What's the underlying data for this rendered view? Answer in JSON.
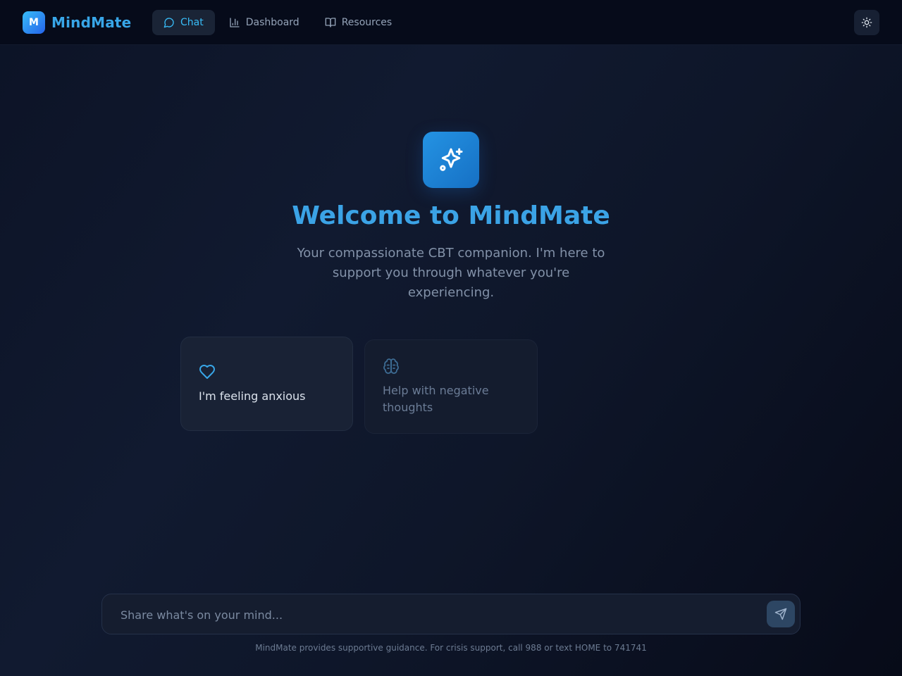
{
  "app": {
    "logo_letter": "M",
    "name": "MindMate"
  },
  "nav": {
    "items": [
      {
        "label": "Chat",
        "icon": "chat-bubble-icon",
        "active": true
      },
      {
        "label": "Dashboard",
        "icon": "bar-chart-icon",
        "active": false
      },
      {
        "label": "Resources",
        "icon": "book-open-icon",
        "active": false
      }
    ]
  },
  "theme_toggle": {
    "icon": "sun-icon"
  },
  "hero": {
    "icon": "sparkles-icon",
    "title": "Welcome to MindMate",
    "subtitle": "Your compassionate CBT companion. I'm here to support you through whatever you're experiencing."
  },
  "suggestions": [
    {
      "label": "I'm feeling anxious",
      "icon": "heart-icon"
    },
    {
      "label": "Help with negative thoughts",
      "icon": "brain-icon"
    }
  ],
  "composer": {
    "placeholder": "Share what's on your mind...",
    "value": "",
    "send_icon": "send-icon"
  },
  "footer": {
    "disclaimer": "MindMate provides supportive guidance. For crisis support, call 988 or text HOME to 741741"
  },
  "colors": {
    "accent": "#38bdf8",
    "brand_gradient_start": "#38bdf8",
    "brand_gradient_end": "#2563eb",
    "background": "#0c1326"
  }
}
